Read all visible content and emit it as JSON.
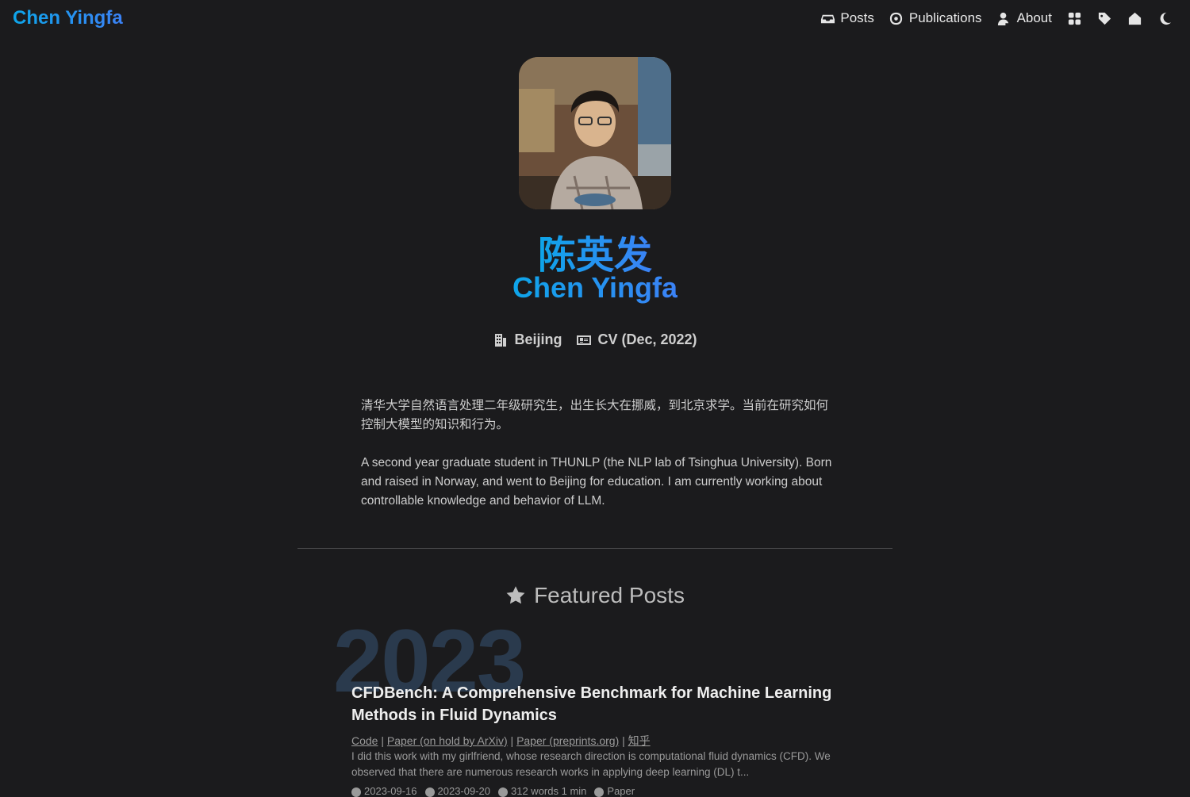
{
  "header": {
    "logo": "Chen Yingfa",
    "nav": [
      {
        "label": "Posts",
        "icon": "inbox-icon"
      },
      {
        "label": "Publications",
        "icon": "atom-icon"
      },
      {
        "label": "About",
        "icon": "user-icon"
      }
    ],
    "icon_buttons": [
      "apps-icon",
      "tag-icon",
      "home-icon",
      "moon-icon"
    ]
  },
  "profile": {
    "name_cn": "陈英发",
    "name_en": "Chen Yingfa",
    "location": "Beijing",
    "cv_label": "CV (Dec, 2022)"
  },
  "bio": {
    "cn": "清华大学自然语言处理二年级研究生，出生长大在挪威，到北京求学。当前在研究如何控制大模型的知识和行为。",
    "en": "A second year graduate student in THUNLP (the NLP lab of Tsinghua University). Born and raised in Norway, and went to Beijing for education. I am currently working about controllable knowledge and behavior of LLM."
  },
  "featured": {
    "heading": "Featured Posts",
    "year": "2023",
    "post": {
      "title": "CFDBench: A Comprehensive Benchmark for Machine Learning Methods in Fluid Dynamics",
      "links": [
        "Code",
        "Paper (on hold by ArXiv)",
        "Paper (preprints.org)",
        "知乎"
      ],
      "excerpt": "I did this work with my girlfriend, whose research direction is computational fluid dynamics (CFD). We observed that there are numerous research works in applying deep learning (DL) t...",
      "date": "2023-09-16",
      "updated": "2023-09-20",
      "words": "312 words",
      "read_time": "1 min",
      "category": "Paper"
    }
  },
  "colors": {
    "background": "#1b1b1d",
    "accent_start": "#0ea5e9",
    "accent_end": "#3b82f6",
    "year_watermark": "#2a3a4d"
  }
}
